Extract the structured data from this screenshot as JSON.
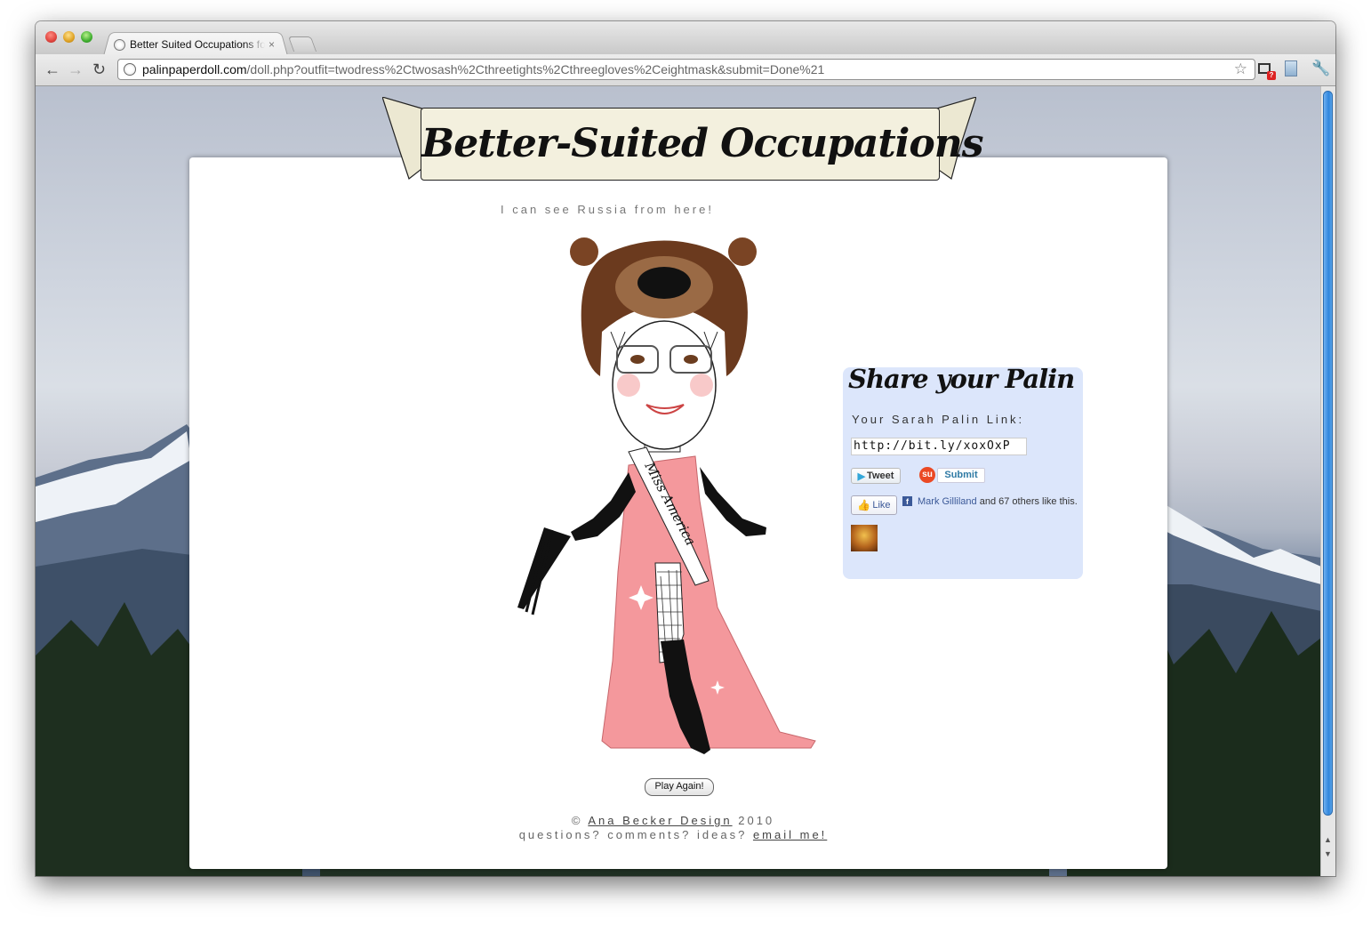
{
  "browser": {
    "tab_title": "Better Suited Occupations for",
    "tab_close": "×",
    "url_host": "palinpaperdoll.com",
    "url_path": "/doll.php?outfit=twodress%2Ctwosash%2Cthreetights%2Cthreegloves%2Ceightmask&submit=Done%21",
    "back_glyph": "←",
    "forward_glyph": "→",
    "reload_glyph": "↻",
    "star_glyph": "☆",
    "wrench_glyph": "🔧",
    "ext_badge": "?"
  },
  "page": {
    "banner_title": "Better-Suited Occupations",
    "tagline": "I can see Russia from here!",
    "sash_text": "Miss America",
    "play_again_label": "Play Again!",
    "footer": {
      "copyright_symbol": "©",
      "designer_link": "Ana Becker Design",
      "year": "2010",
      "questions_text": "questions? comments? ideas?",
      "email_link": "email me!"
    }
  },
  "share": {
    "title": "Share your Palin",
    "link_label": "Your Sarah Palin Link:",
    "link_value": "http://bit.ly/xoxOxP",
    "tweet_label": "Tweet",
    "stumble_icon": "su",
    "submit_label": "Submit",
    "like_label": "Like",
    "like_name": "Mark Gilliland",
    "like_rest": "and 67 others like this."
  },
  "colors": {
    "card_bg": "#ffffff",
    "banner_bg": "#f3f0de",
    "share_bg": "#dce6fb",
    "dress": "#f4989c",
    "bear": "#6b3a1e",
    "link_blue": "#3b5998"
  }
}
